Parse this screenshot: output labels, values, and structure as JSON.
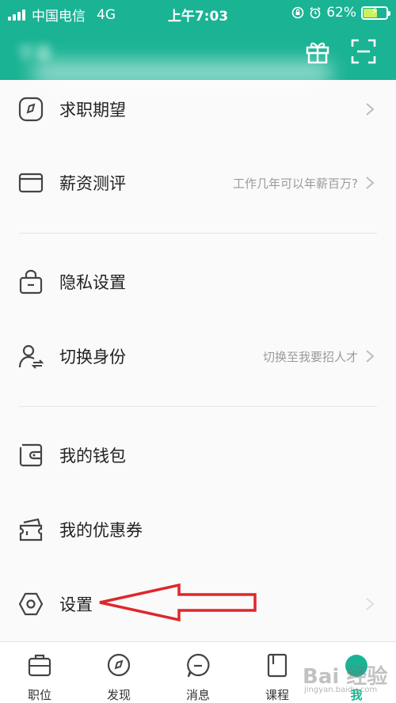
{
  "status_bar": {
    "carrier": "中国电信",
    "network": "4G",
    "time": "上午7:03",
    "battery": "62%",
    "battery_level": 0.62,
    "icons": [
      "lock-rotation-icon",
      "alarm-icon",
      "battery-charging-icon"
    ]
  },
  "header": {
    "username": "字幕",
    "gift_icon": "gift-icon",
    "scan_icon": "scan-icon"
  },
  "menu": {
    "job_expectation": {
      "label": "求职期望",
      "icon": "compass-icon"
    },
    "salary_eval": {
      "label": "薪资测评",
      "hint": "工作几年可以年薪百万?",
      "icon": "card-icon"
    },
    "privacy": {
      "label": "隐私设置",
      "icon": "lock-bag-icon"
    },
    "switch_role": {
      "label": "切换身份",
      "hint": "切换至我要招人才",
      "icon": "switch-user-icon"
    },
    "wallet": {
      "label": "我的钱包",
      "icon": "wallet-icon"
    },
    "coupons": {
      "label": "我的优惠券",
      "icon": "coupon-icon"
    },
    "settings": {
      "label": "设置",
      "icon": "hexagon-settings-icon"
    }
  },
  "tabs": [
    {
      "label": "职位",
      "icon": "briefcase-icon"
    },
    {
      "label": "发现",
      "icon": "compass-icon"
    },
    {
      "label": "消息",
      "icon": "chat-icon"
    },
    {
      "label": "课程",
      "icon": "book-icon"
    },
    {
      "label": "我",
      "icon": "me-icon",
      "active": true
    }
  ],
  "watermark": {
    "text": "Bai 经验",
    "url_text": "jingyan.baidu.com"
  },
  "colors": {
    "brand": "#1ab394",
    "annotation": "#e0262b"
  }
}
